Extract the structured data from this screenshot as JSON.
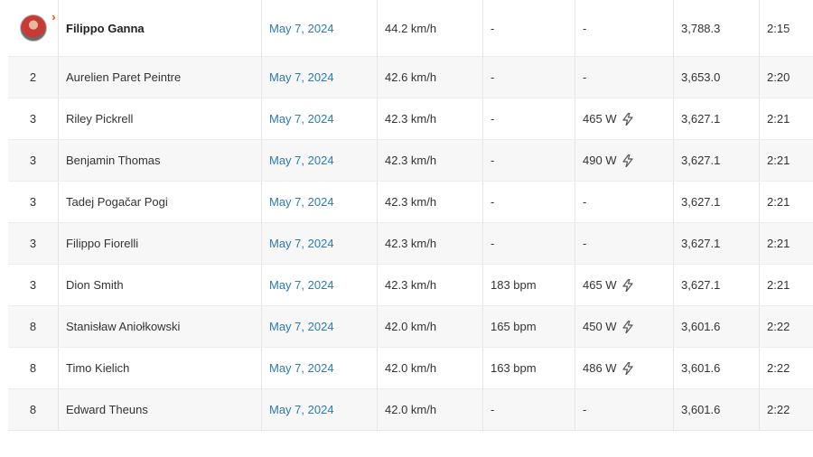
{
  "leaderboard": {
    "rows": [
      {
        "rank": "",
        "athlete": "Filippo Ganna",
        "date": "May 7, 2024",
        "speed": "44.2 km/h",
        "hr": "-",
        "power": "-",
        "vam": "3,788.3",
        "time": "2:15",
        "leader": true
      },
      {
        "rank": "2",
        "athlete": "Aurelien Paret Peintre",
        "date": "May 7, 2024",
        "speed": "42.6 km/h",
        "hr": "-",
        "power": "-",
        "vam": "3,653.0",
        "time": "2:20"
      },
      {
        "rank": "3",
        "athlete": "Riley Pickrell",
        "date": "May 7, 2024",
        "speed": "42.3 km/h",
        "hr": "-",
        "power": "465 W",
        "vam": "3,627.1",
        "time": "2:21"
      },
      {
        "rank": "3",
        "athlete": "Benjamin Thomas",
        "date": "May 7, 2024",
        "speed": "42.3 km/h",
        "hr": "-",
        "power": "490 W",
        "vam": "3,627.1",
        "time": "2:21"
      },
      {
        "rank": "3",
        "athlete": "Tadej Pogačar Pogi",
        "date": "May 7, 2024",
        "speed": "42.3 km/h",
        "hr": "-",
        "power": "-",
        "vam": "3,627.1",
        "time": "2:21"
      },
      {
        "rank": "3",
        "athlete": "Filippo Fiorelli",
        "date": "May 7, 2024",
        "speed": "42.3 km/h",
        "hr": "-",
        "power": "-",
        "vam": "3,627.1",
        "time": "2:21"
      },
      {
        "rank": "3",
        "athlete": "Dion Smith",
        "date": "May 7, 2024",
        "speed": "42.3 km/h",
        "hr": "183 bpm",
        "power": "465 W",
        "vam": "3,627.1",
        "time": "2:21"
      },
      {
        "rank": "8",
        "athlete": "Stanisław Aniołkowski",
        "date": "May 7, 2024",
        "speed": "42.0 km/h",
        "hr": "165 bpm",
        "power": "450 W",
        "vam": "3,601.6",
        "time": "2:22"
      },
      {
        "rank": "8",
        "athlete": "Timo Kielich",
        "date": "May 7, 2024",
        "speed": "42.0 km/h",
        "hr": "163 bpm",
        "power": "486 W",
        "vam": "3,601.6",
        "time": "2:22"
      },
      {
        "rank": "8",
        "athlete": "Edward Theuns",
        "date": "May 7, 2024",
        "speed": "42.0 km/h",
        "hr": "-",
        "power": "-",
        "vam": "3,601.6",
        "time": "2:22"
      }
    ]
  },
  "colors": {
    "link": "#2a7ab8",
    "accent": "#fc5200",
    "row_shade": "#f7f7f7"
  },
  "icons": {
    "leader_badge": "crown-chevron-icon",
    "power_meter": "lightning-bolt-icon"
  }
}
